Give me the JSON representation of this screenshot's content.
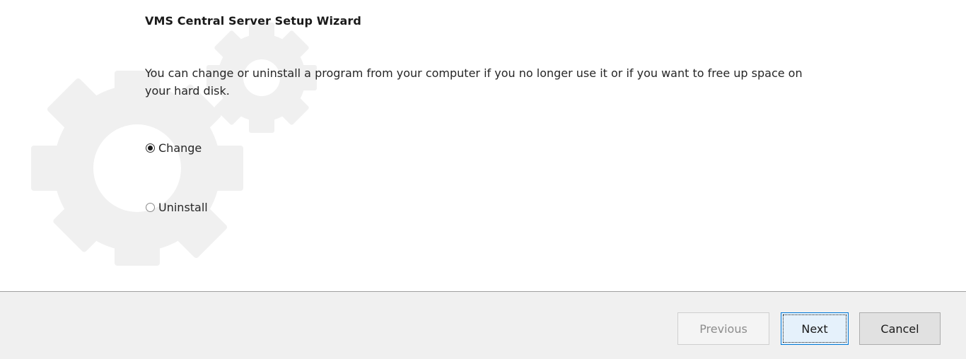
{
  "wizard": {
    "title": "VMS Central Server Setup Wizard",
    "description": "You can change or uninstall a program from your computer if you no longer use it or if you want to free up space on your hard disk.",
    "options": [
      {
        "label": "Change",
        "selected": true
      },
      {
        "label": "Uninstall",
        "selected": false
      }
    ]
  },
  "footer": {
    "previous_label": "Previous",
    "next_label": "Next",
    "cancel_label": "Cancel",
    "previous_enabled": false
  },
  "colors": {
    "watermark": "#f0f0f0",
    "footer_bg": "#f0f0f0",
    "focus_border": "#0078d7"
  },
  "icons": {
    "watermark": "gears-watermark-icon"
  }
}
